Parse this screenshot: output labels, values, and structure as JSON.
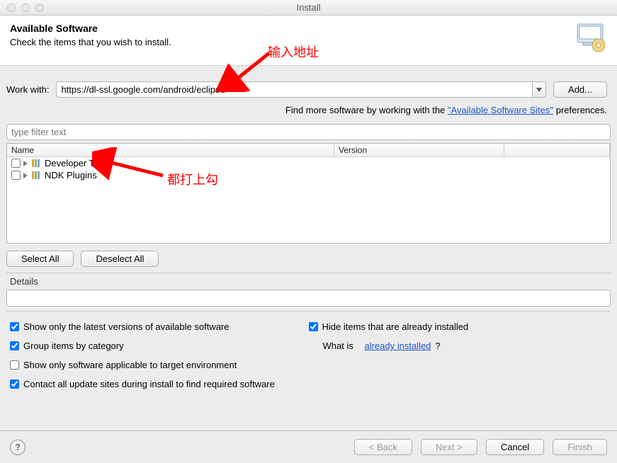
{
  "window": {
    "title": "Install"
  },
  "banner": {
    "heading": "Available Software",
    "subheading": "Check the items that you wish to install."
  },
  "workwith": {
    "label": "Work with:",
    "value": "https://dl-ssl.google.com/android/eclipse/",
    "add_button": "Add..."
  },
  "moreline": {
    "prefix": "Find more software by working with the ",
    "link": "\"Available Software Sites\"",
    "suffix": " preferences."
  },
  "filter": {
    "placeholder": "type filter text"
  },
  "tree": {
    "cols": {
      "name": "Name",
      "version": "Version"
    },
    "rows": [
      {
        "label": "Developer Tools"
      },
      {
        "label": "NDK Plugins"
      }
    ]
  },
  "select": {
    "all": "Select All",
    "none": "Deselect All"
  },
  "details": {
    "label": "Details"
  },
  "options": {
    "left": [
      {
        "checked": true,
        "label": "Show only the latest versions of available software"
      },
      {
        "checked": true,
        "label": "Group items by category"
      },
      {
        "checked": false,
        "label": "Show only software applicable to target environment"
      },
      {
        "checked": true,
        "label": "Contact all update sites during install to find required software"
      }
    ],
    "right_check": {
      "checked": true,
      "label": "Hide items that are already installed"
    },
    "right_link": {
      "prefix": "What is ",
      "link": "already installed",
      "suffix": "?"
    }
  },
  "footer": {
    "back": "< Back",
    "next": "Next >",
    "cancel": "Cancel",
    "finish": "Finish"
  },
  "annotations": {
    "text1": "输入地址",
    "text2": "都打上勾"
  }
}
